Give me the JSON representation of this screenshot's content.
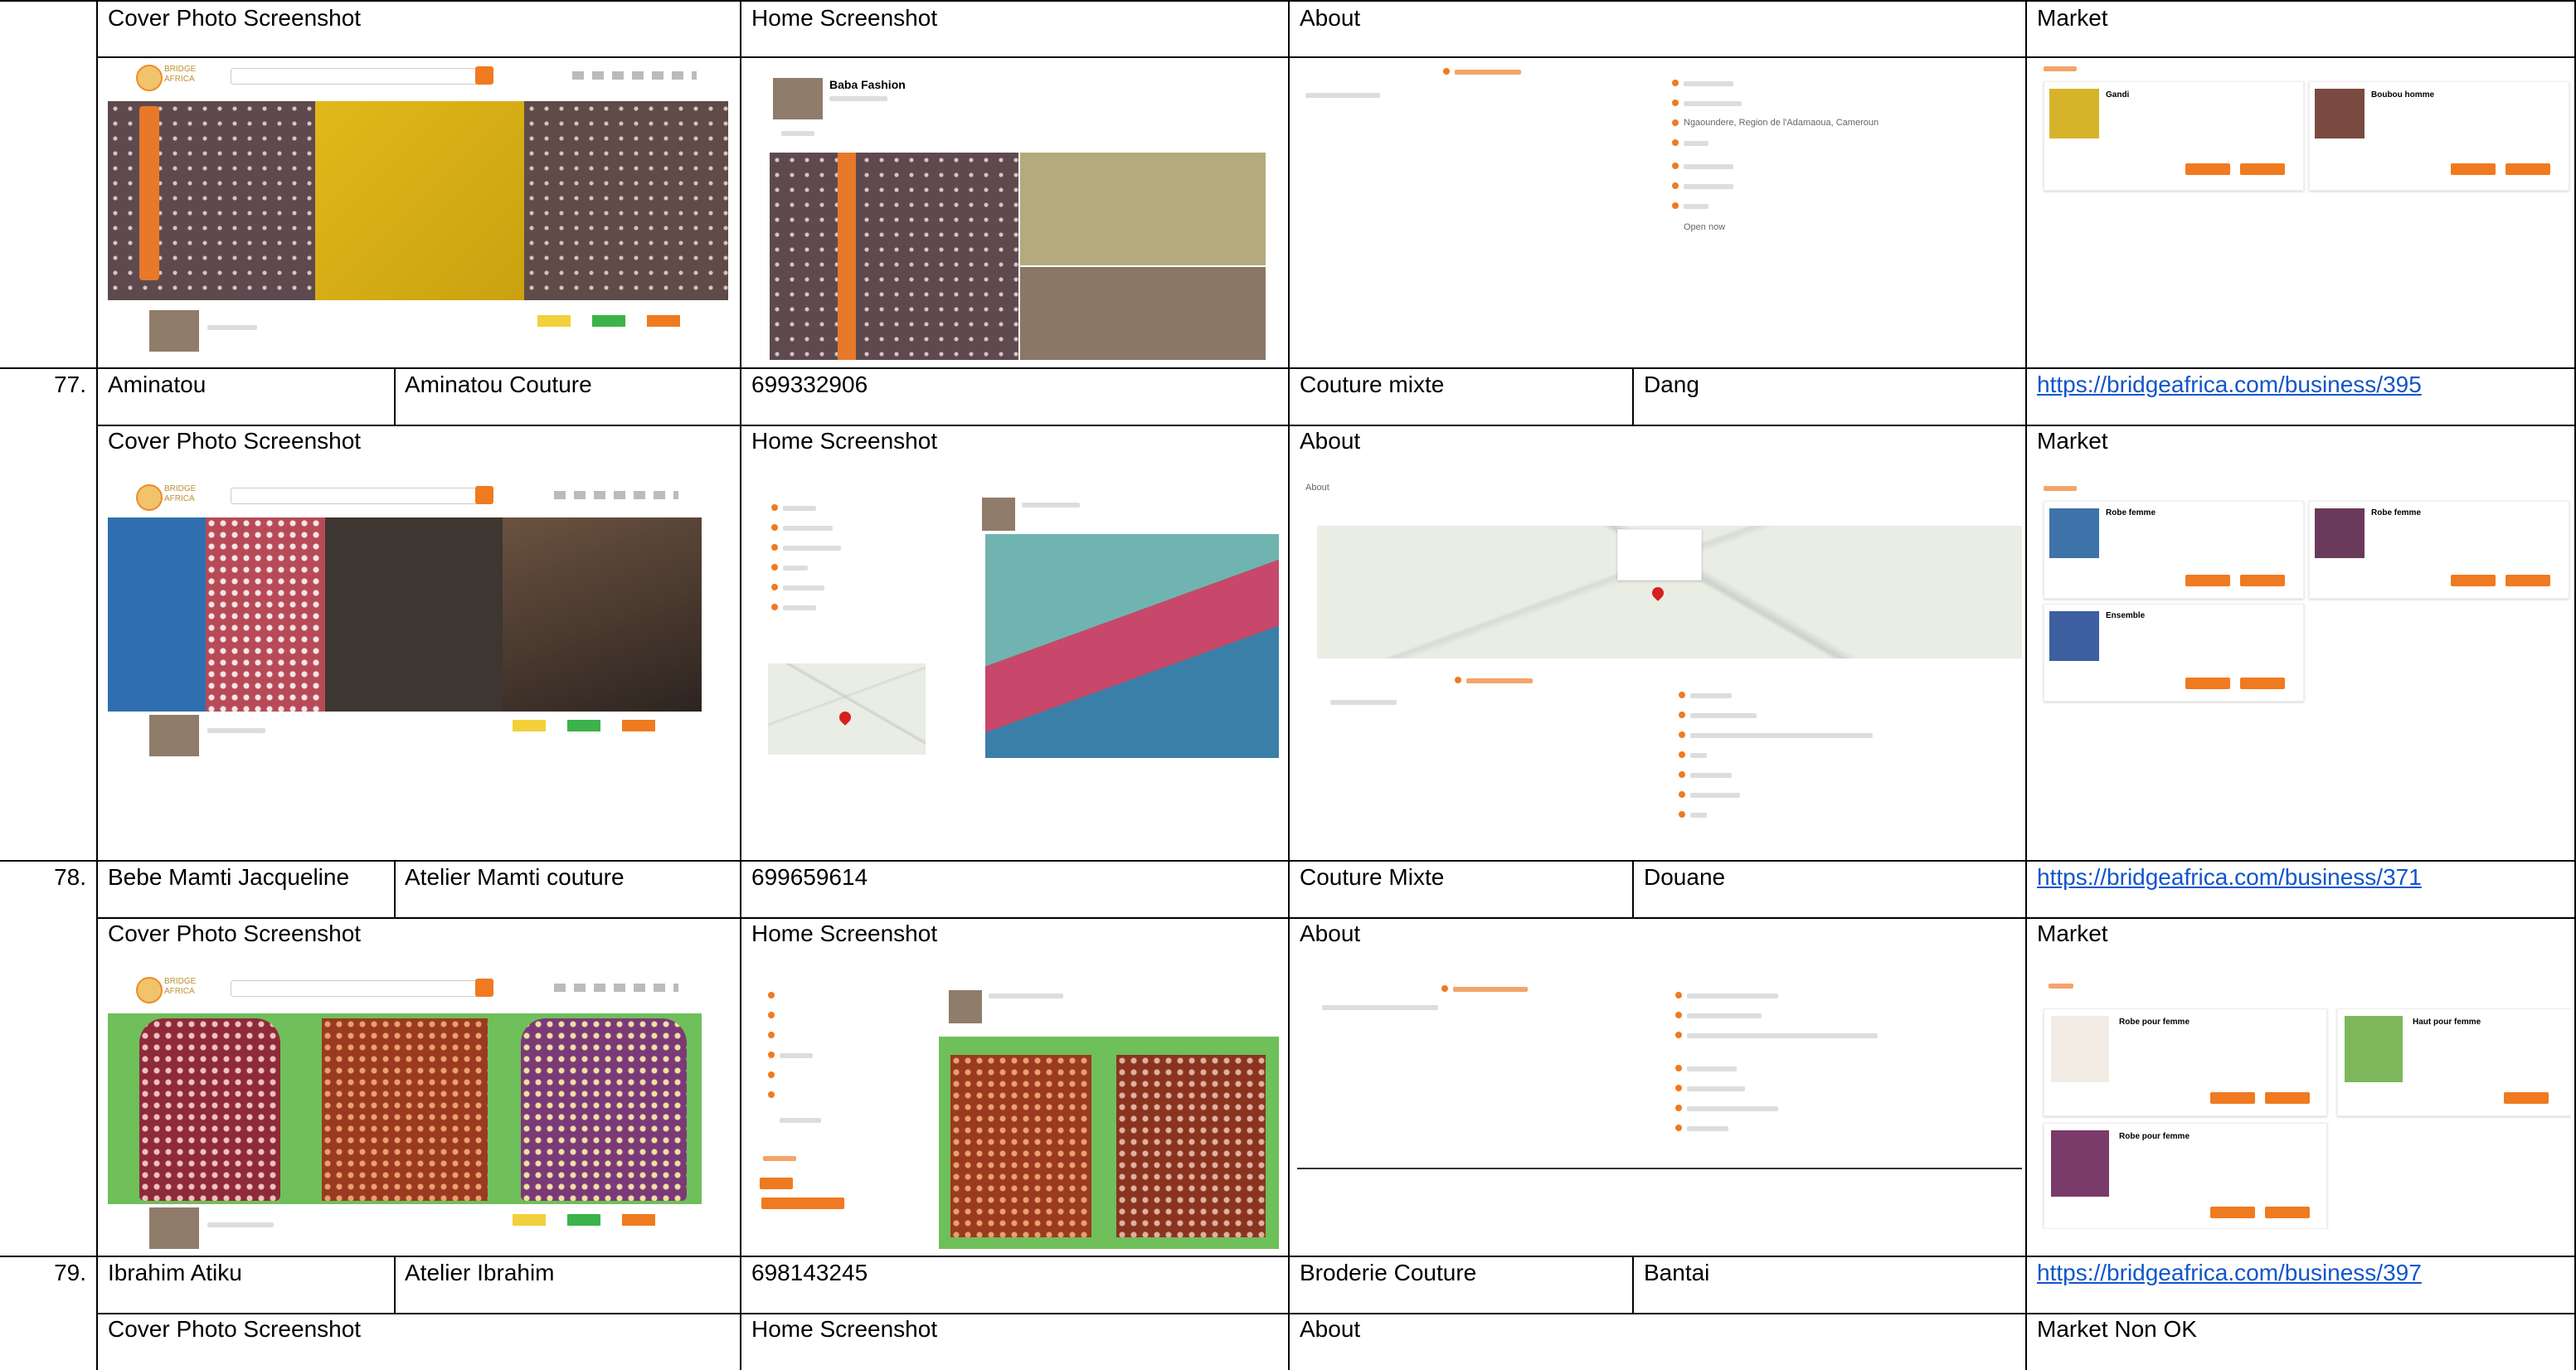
{
  "section_labels": {
    "cover": "Cover Photo Screenshot",
    "home": "Home Screenshot",
    "about": "About",
    "market": "Market",
    "market_non_ok": "Market Non OK"
  },
  "rows": [
    {
      "number": "77.",
      "name": "Aminatou",
      "business": "Aminatou Couture",
      "phone": "699332906",
      "category": "Couture mixte",
      "location": "Dang",
      "url": "https://bridgeafrica.com/business/395"
    },
    {
      "number": "78.",
      "name": "Bebe Mamti Jacqueline",
      "business": "Atelier Mamti couture",
      "phone": "699659614",
      "category": "Couture Mixte",
      "location": "Douane",
      "url": "https://bridgeafrica.com/business/371"
    },
    {
      "number": "79.",
      "name": "Ibrahim Atiku",
      "business": "Atelier Ibrahim",
      "phone": "698143245",
      "category": "Broderie Couture",
      "location": "Bantai",
      "url": "https://bridgeafrica.com/business/397"
    }
  ],
  "screens": {
    "top": {
      "profile_name": "Baba Fashion",
      "about_address": "Ngaoundere, Region de l'Adamaoua, Cameroun",
      "open_now": "Open now",
      "market_items": [
        "Gandi",
        "Boubou homme"
      ]
    },
    "row77": {
      "about_header": "About",
      "market_items": [
        "Robe femme",
        "Robe femme",
        "Ensemble"
      ]
    },
    "row78": {
      "market_items": [
        "Robe pour femme",
        "Haut pour femme",
        "Robe pour femme"
      ]
    }
  },
  "colors": {
    "accent": "#f07a20",
    "link": "#1155cc",
    "brand_gold": "#c0902f"
  }
}
